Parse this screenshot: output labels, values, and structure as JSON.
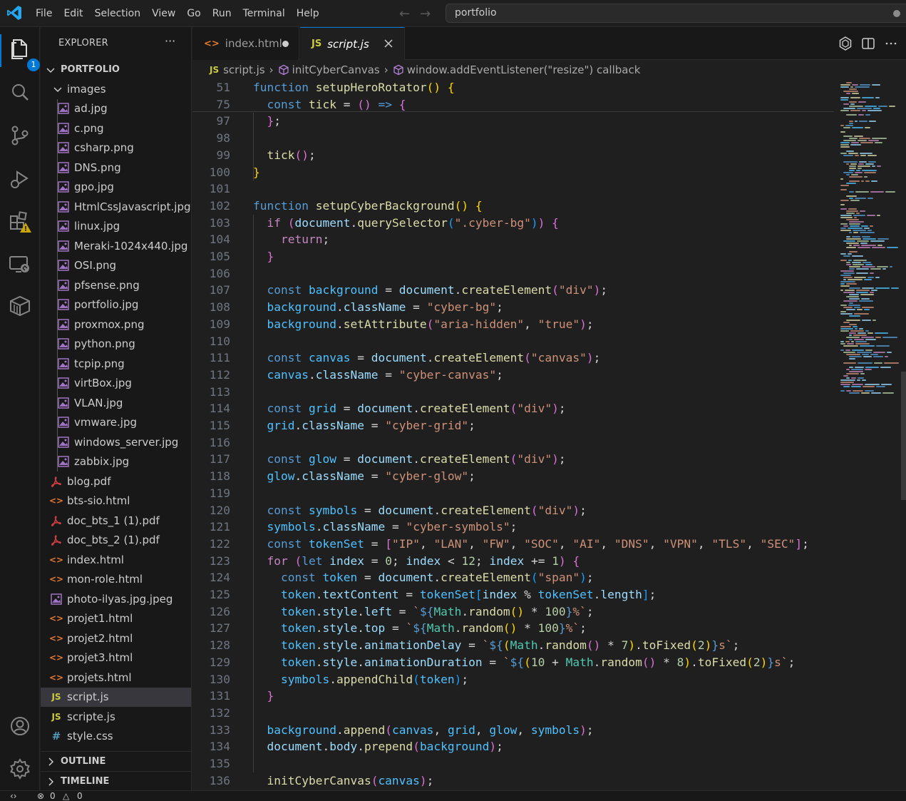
{
  "titlebar": {
    "menu": [
      "File",
      "Edit",
      "Selection",
      "View",
      "Go",
      "Run",
      "Terminal",
      "Help"
    ],
    "search_text": "portfolio"
  },
  "activitybar": {
    "explorer_badge": "1"
  },
  "sidebar": {
    "title": "EXPLORER",
    "more": "···",
    "root": "PORTFOLIO",
    "folder": "images",
    "images": [
      "ad.jpg",
      "c.png",
      "csharp.png",
      "DNS.png",
      "gpo.jpg",
      "HtmlCssJavascript.jpg",
      "linux.jpg",
      "Meraki-1024x440.jpg",
      "OSI.png",
      "pfsense.png",
      "portfolio.jpg",
      "proxmox.png",
      "python.png",
      "tcpip.png",
      "virtBox.jpg",
      "VLAN.jpg",
      "vmware.jpg",
      "windows_server.jpg",
      "zabbix.jpg"
    ],
    "files": [
      {
        "name": "blog.pdf",
        "type": "pdf"
      },
      {
        "name": "bts-sio.html",
        "type": "html"
      },
      {
        "name": "doc_bts_1 (1).pdf",
        "type": "pdf"
      },
      {
        "name": "doc_bts_2 (1).pdf",
        "type": "pdf"
      },
      {
        "name": "index.html",
        "type": "html"
      },
      {
        "name": "mon-role.html",
        "type": "html"
      },
      {
        "name": "photo-ilyas.jpg.jpeg",
        "type": "image"
      },
      {
        "name": "projet1.html",
        "type": "html"
      },
      {
        "name": "projet2.html",
        "type": "html"
      },
      {
        "name": "projet3.html",
        "type": "html"
      },
      {
        "name": "projets.html",
        "type": "html"
      },
      {
        "name": "script.js",
        "type": "js"
      },
      {
        "name": "scripte.js",
        "type": "js"
      },
      {
        "name": "style.css",
        "type": "css"
      }
    ],
    "outline": "OUTLINE",
    "timeline": "TIMELINE"
  },
  "tabs": [
    {
      "label": "index.html",
      "icon": "html-icon",
      "dirty": true
    },
    {
      "label": "script.js",
      "icon": "js-icon",
      "active": true
    }
  ],
  "breadcrumb": {
    "file_badge": "JS",
    "file": "script.js",
    "symbol1": "initCyberCanvas",
    "symbol2": "window.addEventListener(\"resize\") callback"
  },
  "editor": {
    "line_numbers": [
      "51",
      "75",
      "97",
      "98",
      "99",
      "100",
      "101",
      "102",
      "103",
      "104",
      "105",
      "106",
      "107",
      "108",
      "109",
      "110",
      "111",
      "112",
      "113",
      "114",
      "115",
      "116",
      "117",
      "118",
      "119",
      "120",
      "121",
      "122",
      "123",
      "124",
      "125",
      "126",
      "127",
      "128",
      "129",
      "130",
      "131",
      "132",
      "133",
      "134",
      "135",
      "136"
    ]
  },
  "statusbar": {
    "errors": "0",
    "warnings": "0"
  },
  "colors": {
    "accent": "#0078d4",
    "keyword": "#569cd6",
    "control": "#c586c0",
    "function": "#dcdcaa",
    "variable": "#9cdcfe",
    "string": "#ce9178",
    "number": "#b5cea8",
    "html_icon": "#e37933",
    "js_icon": "#cbcb41",
    "pdf_icon": "#cc3e44",
    "css_icon": "#519aba",
    "image_icon": "#a074c4"
  }
}
